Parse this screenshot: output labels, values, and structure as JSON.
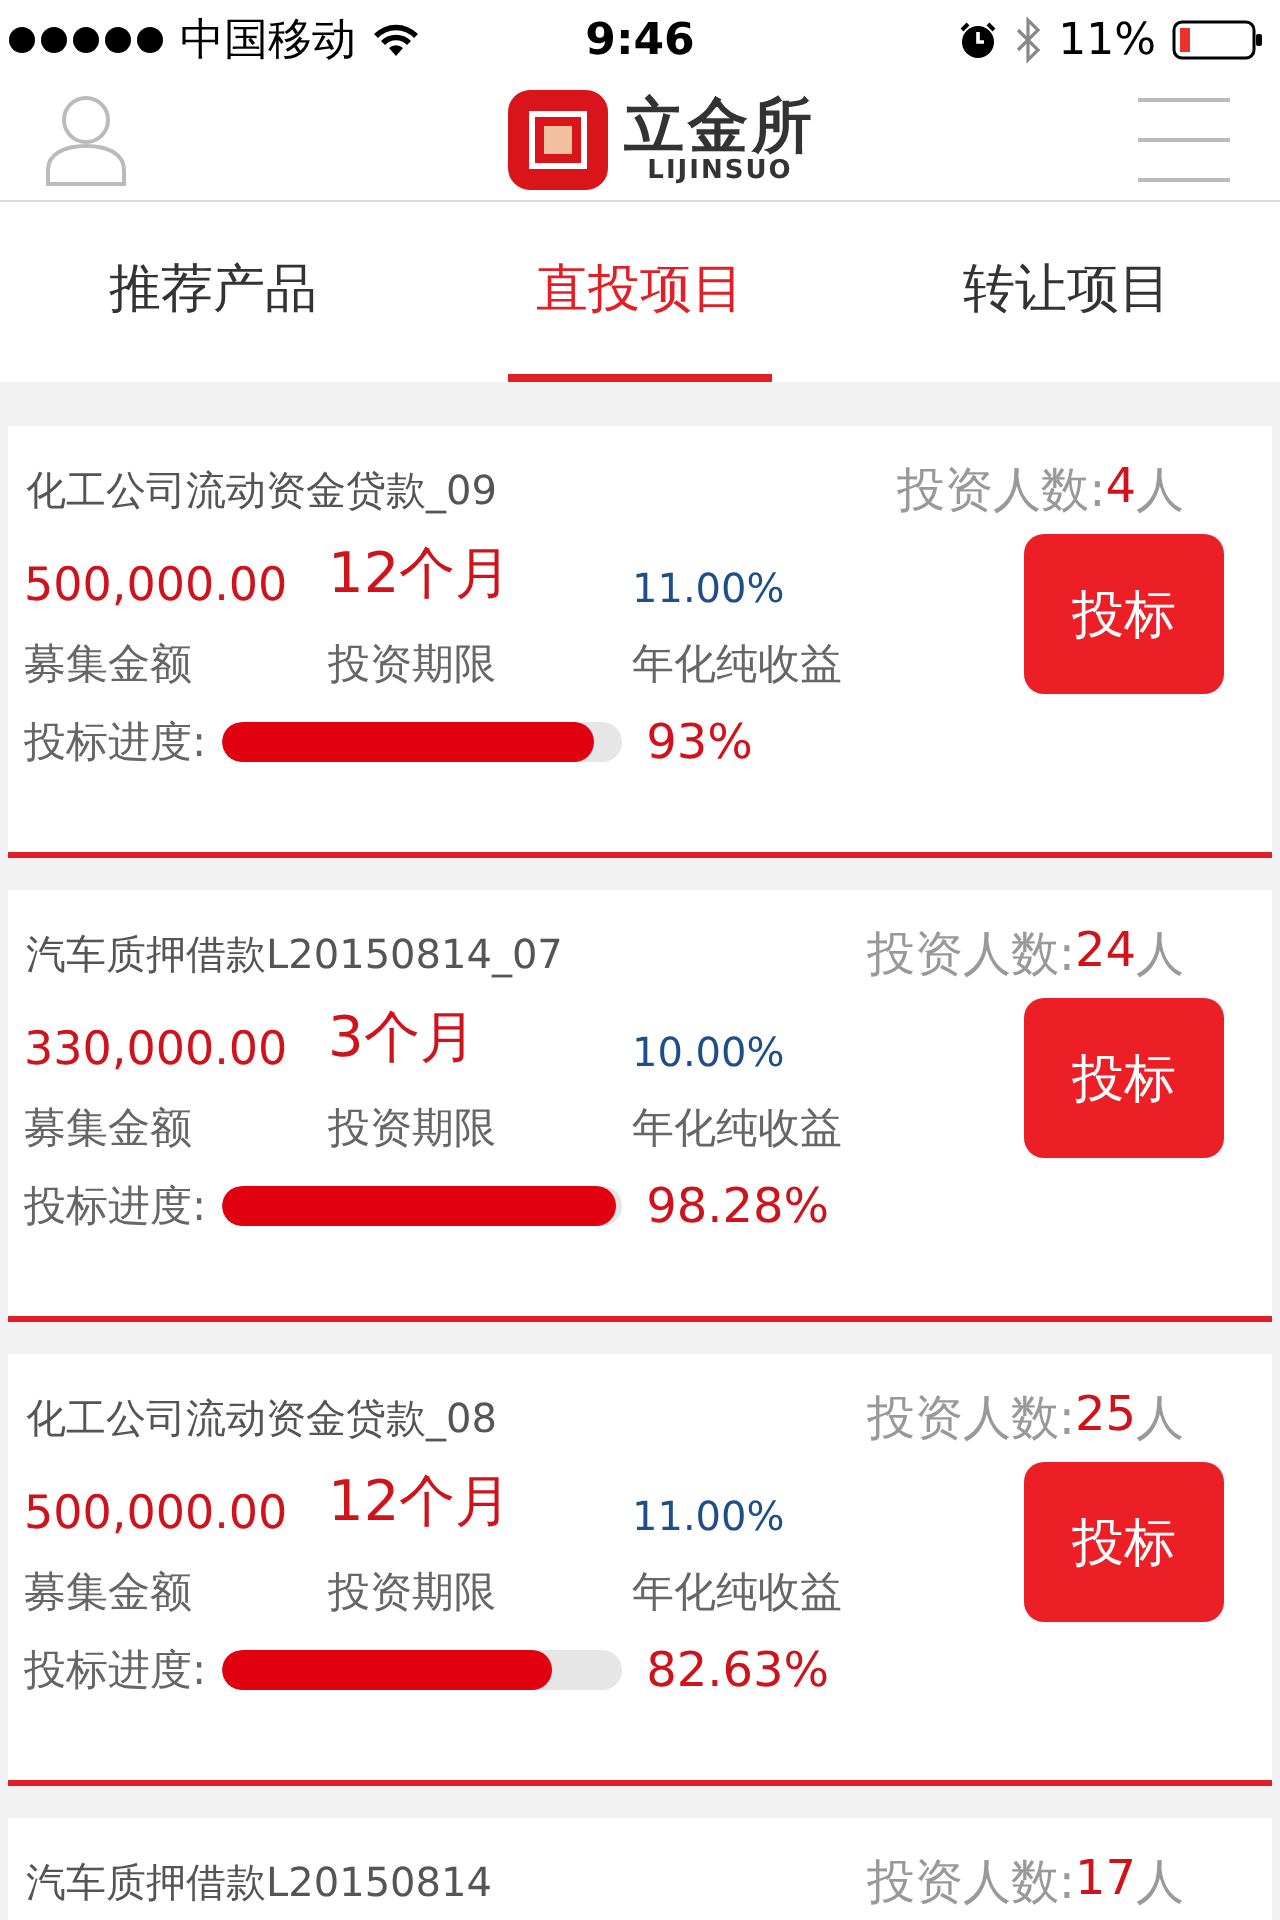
{
  "status_bar": {
    "carrier": "中国移动",
    "time": "9:46",
    "battery": "11%"
  },
  "header": {
    "logo_name": "立金所",
    "logo_sub": "LIJINSUO"
  },
  "tabs": [
    {
      "label": "推荐产品",
      "selected": false
    },
    {
      "label": "直投项目",
      "selected": true
    },
    {
      "label": "转让项目",
      "selected": false
    }
  ],
  "projects": [
    {
      "title": "化工公司流动资金贷款_09",
      "investors_label": "投资人数:",
      "investors": "4",
      "investors_unit": "人",
      "amount": "500,000.00",
      "term": "12个月",
      "rate": "11.00%",
      "amount_label": "募集金额",
      "term_label": "投资期限",
      "rate_label": "年化纯收益",
      "button": "投标",
      "progress_label": "投标进度:",
      "level": 0.93,
      "progress": "93%"
    },
    {
      "title": "汽车质押借款L20150814_07",
      "investors_label": "投资人数:",
      "investors": "24",
      "investors_unit": "人",
      "amount": "330,000.00",
      "term": "3个月",
      "rate": "10.00%",
      "amount_label": "募集金额",
      "term_label": "投资期限",
      "rate_label": "年化纯收益",
      "button": "投标",
      "progress_label": "投标进度:",
      "level": 0.9828,
      "progress": "98.28%"
    },
    {
      "title": "化工公司流动资金贷款_08",
      "investors_label": "投资人数:",
      "investors": "25",
      "investors_unit": "人",
      "amount": "500,000.00",
      "term": "12个月",
      "rate": "11.00%",
      "amount_label": "募集金额",
      "term_label": "投资期限",
      "rate_label": "年化纯收益",
      "button": "投标",
      "progress_label": "投标进度:",
      "level": 0.8263,
      "progress": "82.63%"
    },
    {
      "title": "汽车质押借款L20150814",
      "investors_label": "投资人数:",
      "investors": "17",
      "investors_unit": "人"
    }
  ]
}
